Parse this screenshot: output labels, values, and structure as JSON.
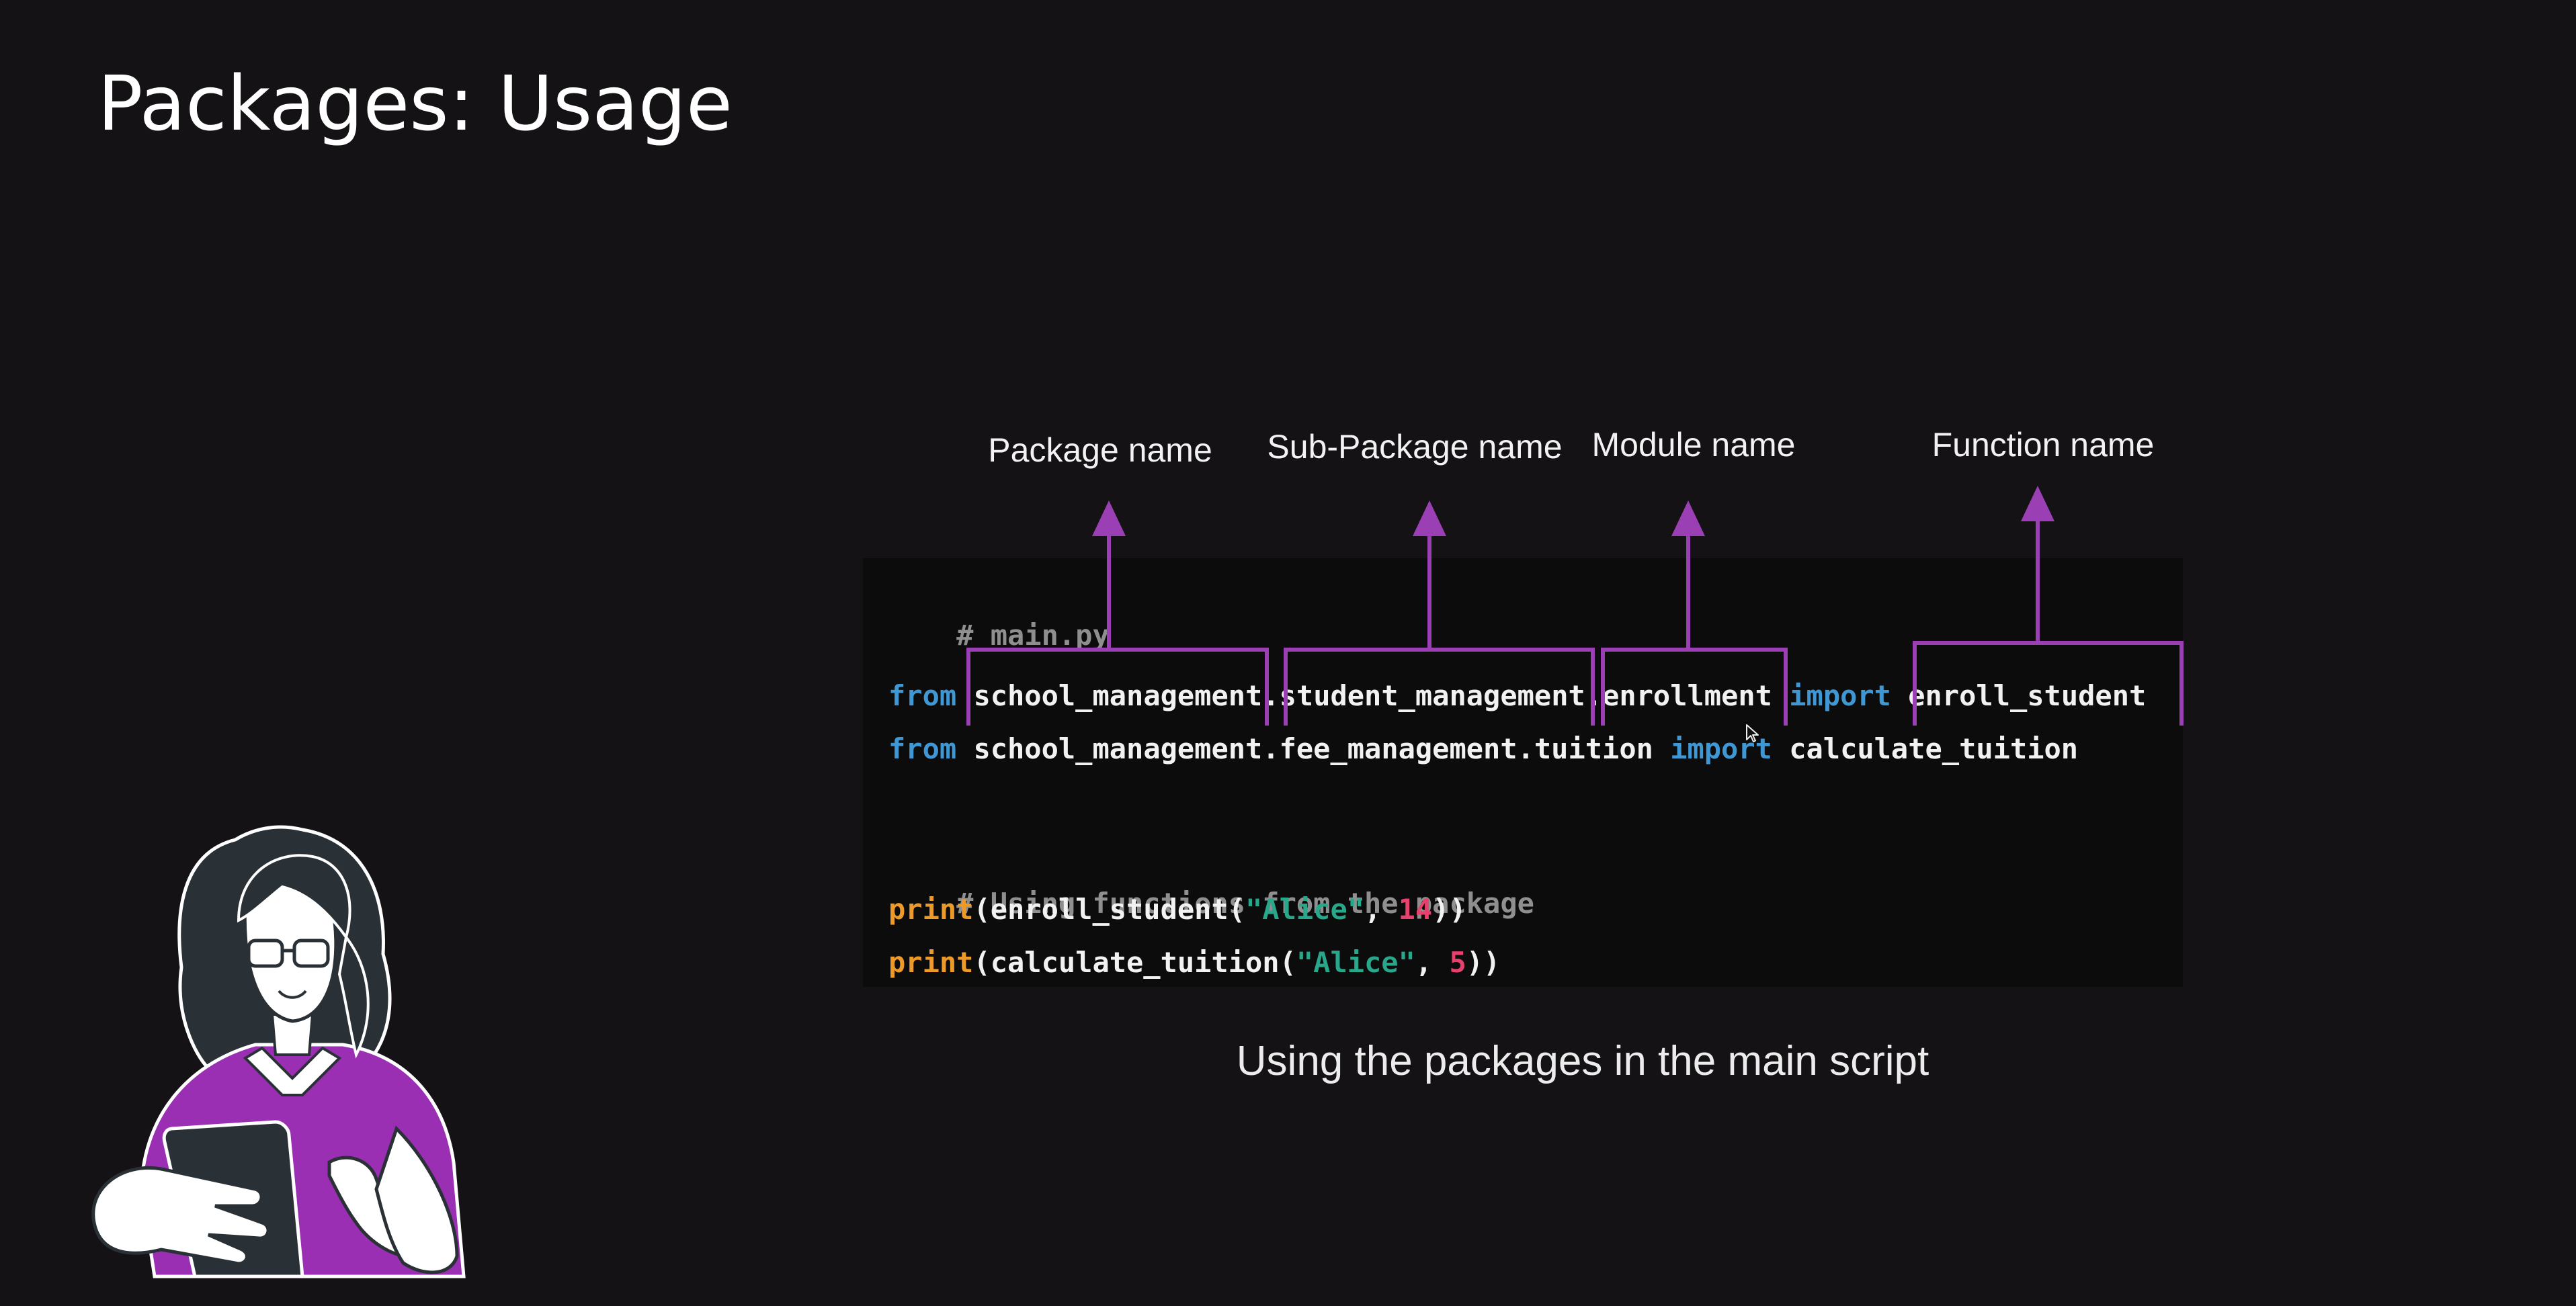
{
  "slide": {
    "title": "Packages: Usage",
    "caption": "Using the packages in the main script"
  },
  "annotations": {
    "package_label": "Package name",
    "subpackage_label": "Sub-Package name",
    "module_label": "Module name",
    "function_label": "Function name"
  },
  "code": {
    "filename_comment": "# main.py",
    "line1": {
      "kw_from": "from",
      "package": "school_management",
      "dot1": ".",
      "subpackage": "student_management",
      "dot2": ".",
      "module": "enrollment",
      "kw_import": "import",
      "function": "enroll_student"
    },
    "line2": {
      "kw_from": "from",
      "path": "school_management.fee_management.tuition",
      "kw_import": "import",
      "function": "calculate_tuition"
    },
    "usage_comment": "# Using functions from the package",
    "line3": {
      "print": "print",
      "open": "(enroll_student(",
      "string": "\"Alice\"",
      "sep": ", ",
      "number": "14",
      "close": "))"
    },
    "line4": {
      "print": "print",
      "open": "(calculate_tuition(",
      "string": "\"Alice\"",
      "sep": ", ",
      "number": "5",
      "close": "))"
    }
  },
  "colors": {
    "background": "#141215",
    "code_background": "#0c0c0c",
    "annotation_purple": "#9b3fb5",
    "keyword_blue": "#3f97d3",
    "builtin_orange": "#ec9a2a",
    "string_green": "#28a78b",
    "number_pink": "#e7416e",
    "comment_gray": "#8f8f8f"
  },
  "icons": {
    "illustration": "woman-with-tablet-illustration",
    "cursor": "mouse-pointer-icon"
  }
}
